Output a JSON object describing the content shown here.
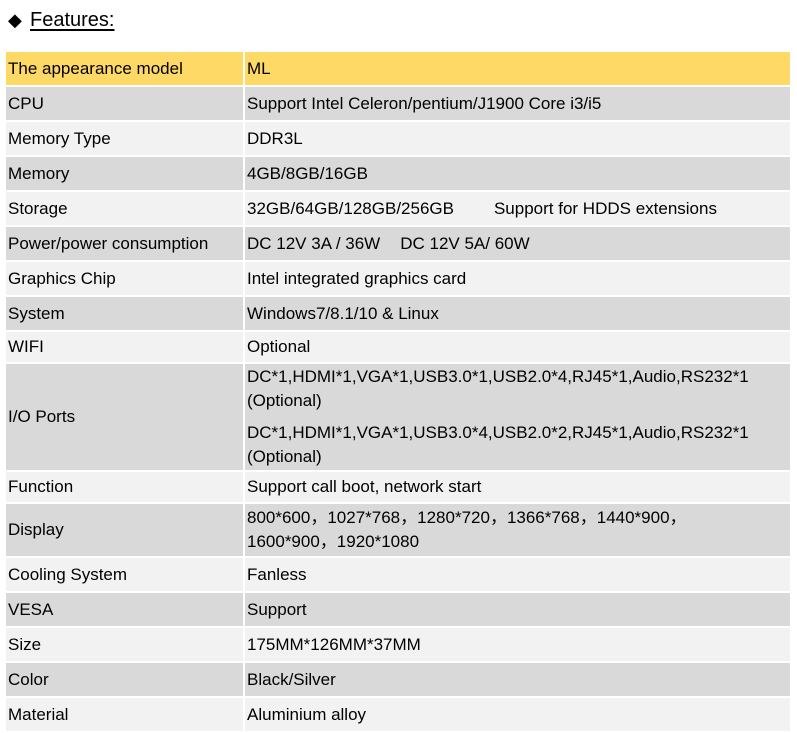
{
  "heading": {
    "bullet": "◆",
    "title": "Features:"
  },
  "colors": {
    "header_row": "#ffd966",
    "row_gray": "#d9d9d9",
    "row_light": "#f2f2f2"
  },
  "rows": [
    {
      "label": "The appearance model",
      "value": "ML"
    },
    {
      "label": "CPU",
      "value": "Support Intel Celeron/pentium/J1900 Core i3/i5"
    },
    {
      "label": "Memory Type",
      "value": "DDR3L"
    },
    {
      "label": "Memory",
      "value": "4GB/8GB/16GB"
    },
    {
      "label": "Storage",
      "value_a": "32GB/64GB/128GB/256GB",
      "value_b": "Support for HDDS extensions"
    },
    {
      "label": "Power/power consumption",
      "value_a": "DC 12V 3A / 36W",
      "value_b": "DC 12V 5A/ 60W"
    },
    {
      "label": "Graphics Chip",
      "value": "Intel integrated graphics card"
    },
    {
      "label": "System",
      "value": "Windows7/8.1/10 & Linux"
    },
    {
      "label": "WIFI",
      "value": "Optional"
    },
    {
      "label": "I/O Ports",
      "line1": "DC*1,HDMI*1,VGA*1,USB3.0*1,USB2.0*4,RJ45*1,Audio,RS232*1",
      "line2": "(Optional)",
      "line3": "DC*1,HDMI*1,VGA*1,USB3.0*4,USB2.0*2,RJ45*1,Audio,RS232*1",
      "line4": "(Optional)"
    },
    {
      "label": "Function",
      "value": "Support call boot, network start"
    },
    {
      "label": "Display",
      "line1": "800*600，1027*768，1280*720，1366*768，1440*900，",
      "line2": "1600*900，1920*1080"
    },
    {
      "label": "Cooling System",
      "value": "Fanless"
    },
    {
      "label": "VESA",
      "value": "Support"
    },
    {
      "label": "Size",
      "value": "175MM*126MM*37MM"
    },
    {
      "label": "Color",
      "value": "Black/Silver"
    },
    {
      "label": "Material",
      "value": "Aluminium alloy"
    }
  ]
}
